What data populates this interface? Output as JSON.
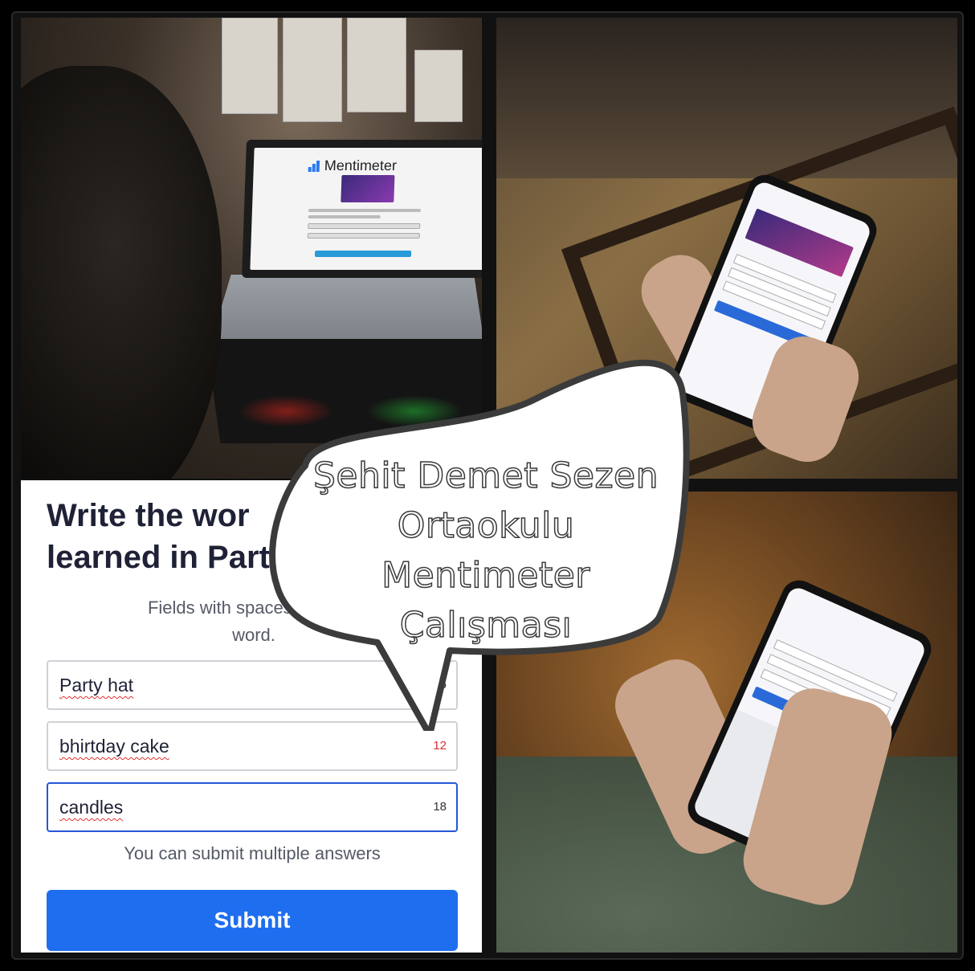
{
  "caption": {
    "lines": [
      "Şehit Demet Sezen",
      "Ortaokulu",
      "Mentimeter Çalışması"
    ]
  },
  "laptop_screen": {
    "logo_text": "Mentimeter"
  },
  "form": {
    "title": "Write the words you have learned in Party Time unit!",
    "title_visible": "Write the wor            learned in Part",
    "hint": "Fields with spaces will be c",
    "hint_tail": "word.",
    "fields": [
      {
        "value": "Party hat",
        "count": "6"
      },
      {
        "value": "bhirtday cake",
        "count": "12"
      },
      {
        "value": "candles",
        "count": "18"
      }
    ],
    "multi_note": "You can submit multiple answers",
    "submit_label": "Submit"
  },
  "colors": {
    "primary": "#1f6ef0",
    "title": "#1f2236",
    "active_border": "#2557d6",
    "warning_count": "#d62b2b"
  }
}
